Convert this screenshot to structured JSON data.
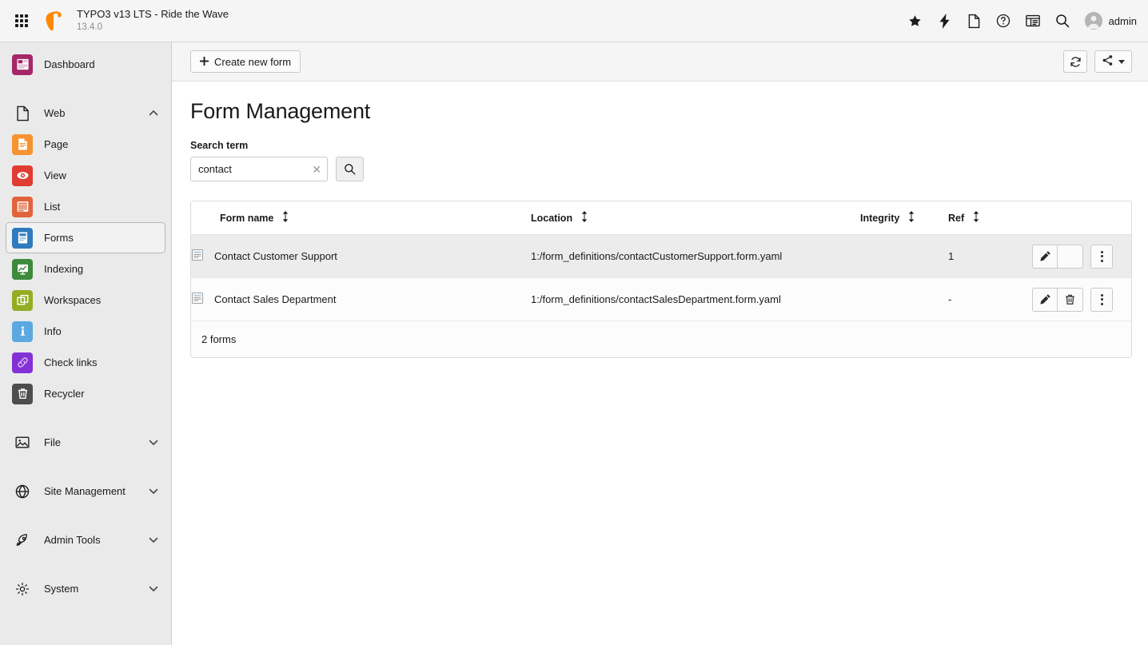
{
  "topbar": {
    "menu_icon": "waffle-grid-icon",
    "logo_icon": "typo3-logo-icon",
    "brand_title": "TYPO3 v13 LTS - Ride the Wave",
    "brand_version": "13.4.0",
    "actions": [
      {
        "name": "bookmarks-star-icon",
        "icon": "star"
      },
      {
        "name": "flash-bolt-icon",
        "icon": "bolt"
      },
      {
        "name": "new-document-icon",
        "icon": "document"
      },
      {
        "name": "help-question-icon",
        "icon": "question"
      },
      {
        "name": "list-records-icon",
        "icon": "listbox"
      },
      {
        "name": "search-icon",
        "icon": "magnifier"
      }
    ],
    "user_label": "admin",
    "avatar_icon": "user-avatar-icon"
  },
  "sidebar": {
    "items": [
      {
        "label": "Dashboard",
        "icon": "dashboard-icon",
        "color": "#a4276a",
        "type": "module",
        "active": false
      },
      {
        "label": "Web",
        "icon": "page-outline-icon",
        "color": "",
        "type": "section",
        "chevron": "up",
        "active": false
      },
      {
        "label": "Page",
        "icon": "page-icon",
        "color": "#f59331",
        "type": "module",
        "active": false
      },
      {
        "label": "View",
        "icon": "view-eye-icon",
        "color": "#e03c31",
        "type": "module",
        "active": false
      },
      {
        "label": "List",
        "icon": "list-icon",
        "color": "#e0643c",
        "type": "module",
        "active": false
      },
      {
        "label": "Forms",
        "icon": "forms-icon",
        "color": "#2f7bbd",
        "type": "module",
        "active": true
      },
      {
        "label": "Indexing",
        "icon": "indexing-icon",
        "color": "#3c8a3c",
        "type": "module",
        "active": false
      },
      {
        "label": "Workspaces",
        "icon": "workspaces-icon",
        "color": "#94ad23",
        "type": "module",
        "active": false
      },
      {
        "label": "Info",
        "icon": "info-icon",
        "color": "#5ba9e0",
        "type": "module",
        "active": false
      },
      {
        "label": "Check links",
        "icon": "check-links-icon",
        "color": "#8331d6",
        "type": "module",
        "active": false
      },
      {
        "label": "Recycler",
        "icon": "recycler-trash-icon",
        "color": "#4d4d4d",
        "type": "module",
        "active": false
      },
      {
        "label": "File",
        "icon": "image-file-icon",
        "color": "",
        "type": "section",
        "chevron": "down",
        "active": false
      },
      {
        "label": "Site Management",
        "icon": "globe-icon",
        "color": "",
        "type": "section",
        "chevron": "down",
        "active": false
      },
      {
        "label": "Admin Tools",
        "icon": "rocket-icon",
        "color": "",
        "type": "section",
        "chevron": "down",
        "active": false
      },
      {
        "label": "System",
        "icon": "gear-icon",
        "color": "",
        "type": "section",
        "chevron": "down",
        "active": false
      }
    ]
  },
  "docheader": {
    "create_label": "Create new form",
    "create_icon": "plus-icon",
    "refresh_icon": "refresh-icon",
    "share_icon": "share-icon"
  },
  "page": {
    "title": "Form Management",
    "search_label": "Search term",
    "search_value": "contact",
    "search_placeholder": "",
    "clear_icon": "clear-x-icon",
    "submit_icon": "search-icon"
  },
  "table": {
    "columns": [
      {
        "label": "Form name",
        "sort_icon": "sort-updown-icon"
      },
      {
        "label": "Location",
        "sort_icon": "sort-updown-icon"
      },
      {
        "label": "Integrity",
        "sort_icon": "sort-updown-icon"
      },
      {
        "label": "Ref",
        "sort_icon": "sort-updown-icon"
      }
    ],
    "rows": [
      {
        "icon": "form-document-icon",
        "name": "Contact Customer Support",
        "location": "1:/form_definitions/contactCustomerSupport.form.yaml",
        "integrity": "",
        "ref": "1",
        "edit_icon": "pencil-icon",
        "delete_icon": "",
        "delete_enabled": false,
        "more_icon": "more-vertical-icon"
      },
      {
        "icon": "form-document-icon",
        "name": "Contact Sales Department",
        "location": "1:/form_definitions/contactSalesDepartment.form.yaml",
        "integrity": "",
        "ref": "-",
        "edit_icon": "pencil-icon",
        "delete_icon": "trash-icon",
        "delete_enabled": true,
        "more_icon": "more-vertical-icon"
      }
    ],
    "footer": "2 forms"
  },
  "colors": {
    "brand_orange": "#ff8700",
    "topbar_bg": "#f5f5f5",
    "sidebar_bg": "#eaeaea",
    "row_striped": "#ececec"
  }
}
